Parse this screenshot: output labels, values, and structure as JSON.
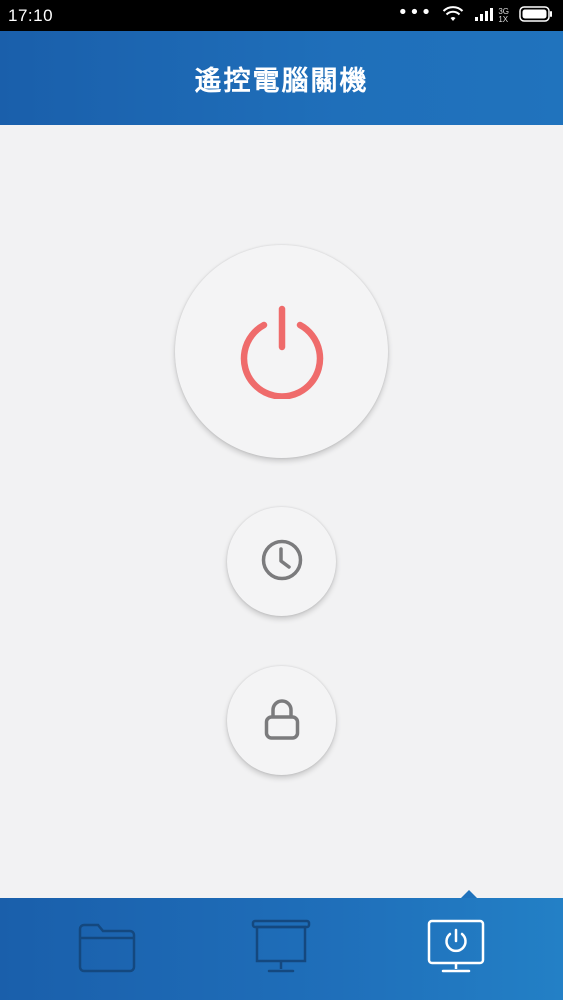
{
  "status_bar": {
    "time": "17:10",
    "network_top": "3G",
    "network_bottom": "1X",
    "dots": "•••"
  },
  "header": {
    "title": "遙控電腦關機"
  },
  "buttons": {
    "power": {
      "icon": "power-icon",
      "color": "#ef6b6b"
    },
    "timer": {
      "icon": "clock-icon",
      "color": "#7b7b7d"
    },
    "lock": {
      "icon": "lock-icon",
      "color": "#7b7b7d"
    }
  },
  "bottom_nav": {
    "tabs": [
      {
        "icon": "folder-icon",
        "active": false
      },
      {
        "icon": "monitor-icon",
        "active": false
      },
      {
        "icon": "monitor-power-icon",
        "active": true
      }
    ],
    "active_color": "#ffffff",
    "inactive_color": "#14487f"
  }
}
